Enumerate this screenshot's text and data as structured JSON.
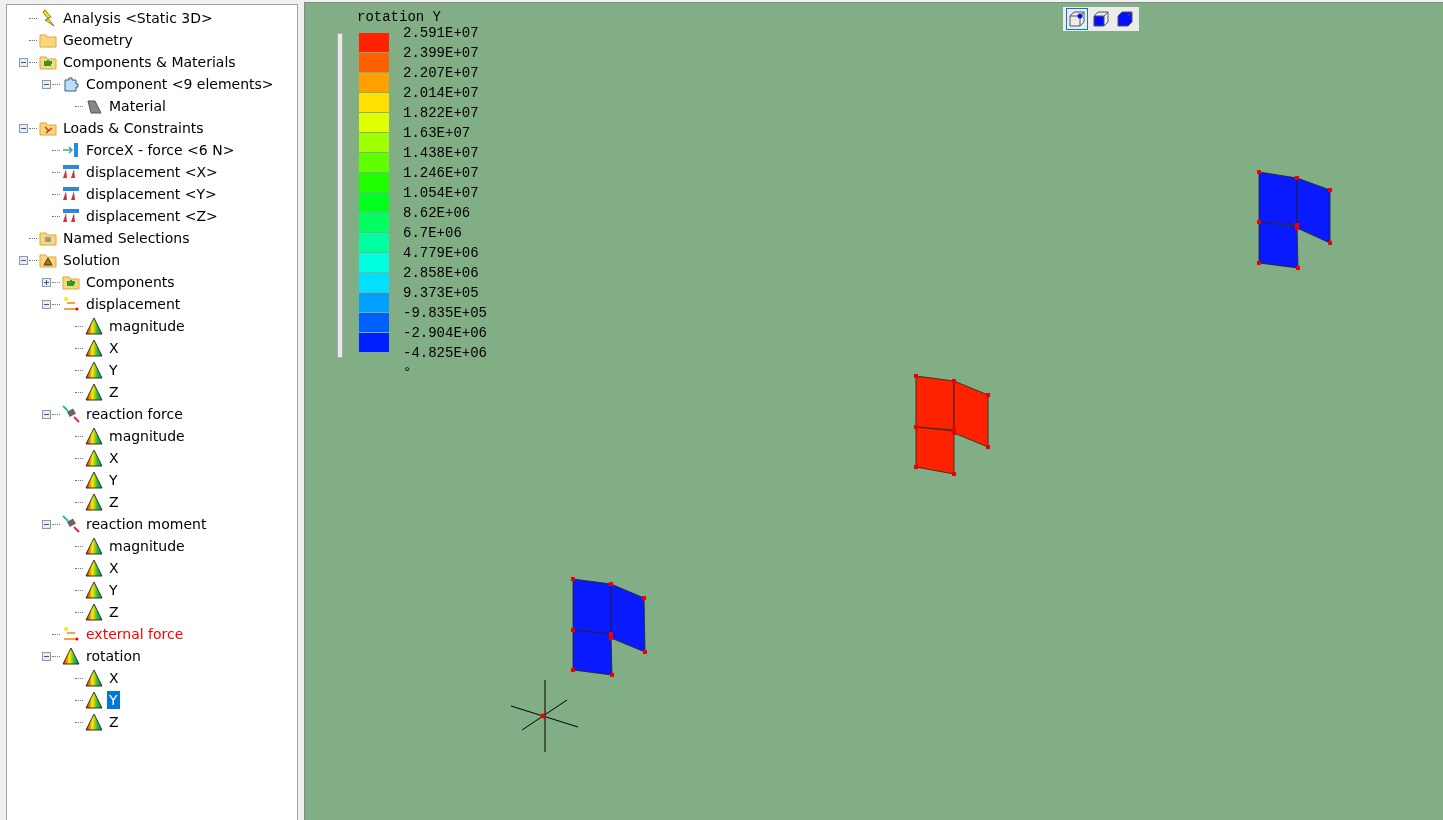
{
  "tree": [
    {
      "label": "Analysis <Static 3D>",
      "kind": "analysis",
      "selected": false,
      "error": false
    },
    {
      "label": "Geometry",
      "kind": "folder",
      "selected": false,
      "error": false
    },
    {
      "label": "Components & Materials",
      "kind": "component-folder",
      "selected": false,
      "error": false,
      "expanded": true,
      "children": [
        {
          "label": "Component <9 elements>",
          "kind": "component",
          "selected": false,
          "error": false,
          "expanded": true,
          "children": [
            {
              "label": "Material",
              "kind": "material",
              "selected": false,
              "error": false
            }
          ]
        }
      ]
    },
    {
      "label": "Loads & Constraints",
      "kind": "loads-folder",
      "selected": false,
      "error": false,
      "expanded": true,
      "children": [
        {
          "label": "ForceX - force <6 N>",
          "kind": "force",
          "selected": false,
          "error": false
        },
        {
          "label": "displacement <X>",
          "kind": "constraint",
          "selected": false,
          "error": false
        },
        {
          "label": "displacement <Y>",
          "kind": "constraint",
          "selected": false,
          "error": false
        },
        {
          "label": "displacement <Z>",
          "kind": "constraint",
          "selected": false,
          "error": false
        }
      ]
    },
    {
      "label": "Named Selections",
      "kind": "selection-folder",
      "selected": false,
      "error": false
    },
    {
      "label": "Solution",
      "kind": "solution",
      "selected": false,
      "error": false,
      "expanded": true,
      "children": [
        {
          "label": "Components",
          "kind": "component-folder",
          "selected": false,
          "error": false,
          "expanded": false
        },
        {
          "label": "displacement",
          "kind": "arrows",
          "selected": false,
          "error": false,
          "expanded": true,
          "children": [
            {
              "label": "magnitude",
              "kind": "result",
              "selected": false,
              "error": false
            },
            {
              "label": "X",
              "kind": "result",
              "selected": false,
              "error": false
            },
            {
              "label": "Y",
              "kind": "result",
              "selected": false,
              "error": false
            },
            {
              "label": "Z",
              "kind": "result",
              "selected": false,
              "error": false
            }
          ]
        },
        {
          "label": "reaction force",
          "kind": "reaction",
          "selected": false,
          "error": false,
          "expanded": true,
          "children": [
            {
              "label": "magnitude",
              "kind": "result",
              "selected": false,
              "error": false
            },
            {
              "label": "X",
              "kind": "result",
              "selected": false,
              "error": false
            },
            {
              "label": "Y",
              "kind": "result",
              "selected": false,
              "error": false
            },
            {
              "label": "Z",
              "kind": "result",
              "selected": false,
              "error": false
            }
          ]
        },
        {
          "label": "reaction moment",
          "kind": "reaction",
          "selected": false,
          "error": false,
          "expanded": true,
          "children": [
            {
              "label": "magnitude",
              "kind": "result",
              "selected": false,
              "error": false
            },
            {
              "label": "X",
              "kind": "result",
              "selected": false,
              "error": false
            },
            {
              "label": "Y",
              "kind": "result",
              "selected": false,
              "error": false
            },
            {
              "label": "Z",
              "kind": "result",
              "selected": false,
              "error": false
            }
          ]
        },
        {
          "label": "external force",
          "kind": "arrows",
          "selected": false,
          "error": true
        },
        {
          "label": "rotation",
          "kind": "result",
          "selected": false,
          "error": false,
          "expanded": true,
          "children": [
            {
              "label": "X",
              "kind": "result",
              "selected": false,
              "error": false
            },
            {
              "label": "Y",
              "kind": "result",
              "selected": true,
              "error": false
            },
            {
              "label": "Z",
              "kind": "result",
              "selected": false,
              "error": false
            }
          ]
        }
      ]
    }
  ],
  "legend": {
    "title": "rotation Y",
    "slider": {
      "level": 1
    },
    "bands": [
      {
        "color": "#ff2200"
      },
      {
        "color": "#ff6000"
      },
      {
        "color": "#ffa000"
      },
      {
        "color": "#ffe000"
      },
      {
        "color": "#e0ff00"
      },
      {
        "color": "#a0ff00"
      },
      {
        "color": "#60ff00"
      },
      {
        "color": "#20ff00"
      },
      {
        "color": "#00ff20"
      },
      {
        "color": "#00ff60"
      },
      {
        "color": "#00ffa0"
      },
      {
        "color": "#00ffe0"
      },
      {
        "color": "#00e0ff"
      },
      {
        "color": "#00a0ff"
      },
      {
        "color": "#0060ff"
      },
      {
        "color": "#0020ff"
      }
    ],
    "values": [
      "2.591E+07",
      "2.399E+07",
      "2.207E+07",
      "2.014E+07",
      "1.822E+07",
      "1.63E+07",
      "1.438E+07",
      "1.246E+07",
      "1.054E+07",
      "8.62E+06",
      "6.7E+06",
      "4.779E+06",
      "2.858E+06",
      "9.373E+05",
      "-9.835E+05",
      "-2.904E+06",
      "-4.825E+06"
    ],
    "unit": "°"
  },
  "view_buttons": [
    {
      "kind": "wireframe",
      "selected": true
    },
    {
      "kind": "shaded-edges",
      "selected": false
    },
    {
      "kind": "shaded",
      "selected": false
    }
  ]
}
